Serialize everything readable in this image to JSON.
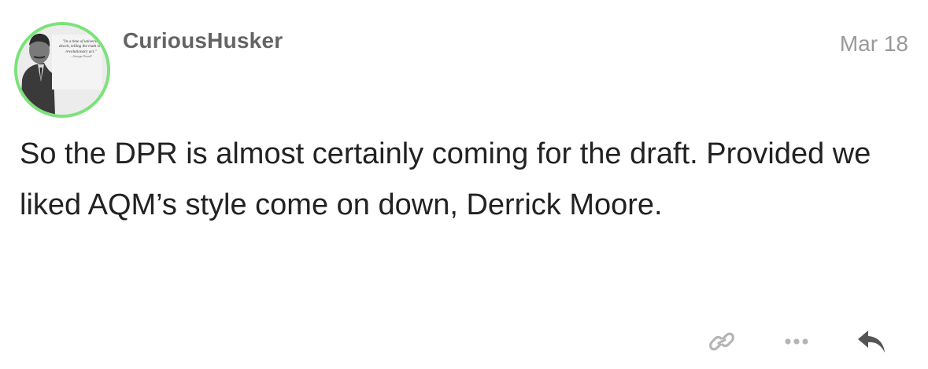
{
  "post": {
    "author": {
      "username": "CuriousHusker",
      "avatar": {
        "quote": "\"In a time of universal deceit, telling the truth is a revolutionary act.\"",
        "attribution": "– George Orwell"
      }
    },
    "date": "Mar 18",
    "body": "So the DPR is almost certainly coming for the draft. Provided we liked AQM’s style come on down, Derrick Moore.",
    "actions": [
      {
        "name": "link",
        "icon": "link-icon"
      },
      {
        "name": "more",
        "icon": "ellipsis-icon"
      },
      {
        "name": "reply",
        "icon": "reply-icon"
      }
    ]
  },
  "colors": {
    "avatar_ring": "#7ce27a",
    "username": "#646464",
    "date": "#999999",
    "body_text": "#222222",
    "action_icon": "#b5b5b5",
    "reply_icon": "#555555"
  }
}
